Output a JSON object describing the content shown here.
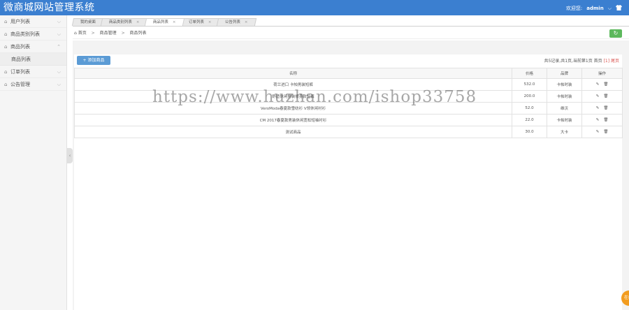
{
  "header": {
    "title": "微商城网站管理系统",
    "welcome": "欢迎您:",
    "username": "admin",
    "dropdown_glyph": "⌵",
    "shirt_icon": "shirt-icon"
  },
  "sidebar": {
    "items": [
      {
        "label": "用户列表",
        "chevron": "⌵"
      },
      {
        "label": "商品类别列表",
        "chevron": "⌵"
      },
      {
        "label": "商品列表",
        "chevron": "⌃"
      },
      {
        "label": "订单列表",
        "chevron": "⌵"
      },
      {
        "label": "公告管理",
        "chevron": "⌵"
      }
    ],
    "subitem": "商品列表",
    "collapse_glyph": "‹"
  },
  "tabs": [
    {
      "label": "我的桌面",
      "close": ""
    },
    {
      "label": "商品类别列表",
      "close": "×"
    },
    {
      "label": "商品列表",
      "close": "×"
    },
    {
      "label": "订单列表",
      "close": "×"
    },
    {
      "label": "公告列表",
      "close": "×"
    }
  ],
  "breadcrumb": {
    "home": "首页",
    "level1": "商品管理",
    "level2": "商品列表",
    "sep": ">",
    "home_glyph": "⌂",
    "refresh_glyph": "↻"
  },
  "toolbar": {
    "add_label": "+ 添加商品",
    "pager_prefix": "共5记录,共1页,当前第1页 首页 ",
    "pager_current": "[1]",
    "pager_last": " 尾页"
  },
  "table": {
    "headers": [
      "名称",
      "价格",
      "品牌",
      "操作"
    ],
    "rows": [
      {
        "name": "荷兰进口 卡帕男装短裤",
        "price": "532.0",
        "brand": "卡帕时装"
      },
      {
        "name": "舒适休闲男装修身款短裤",
        "price": "200.0",
        "brand": "卡帕时装"
      },
      {
        "name": "VeroModa春夏款雪纺衫 V领休闲衬衫",
        "price": "52.0",
        "brand": "维沃"
      },
      {
        "name": "CM 2017春夏款男装休闲宽松短袖衬衫",
        "price": "22.0",
        "brand": "卡帕时装"
      },
      {
        "name": "测试商品",
        "price": "30.0",
        "brand": "大卡"
      }
    ],
    "edit_glyph": "✎",
    "delete_glyph": "🗑"
  },
  "watermark": "https://www.huzhan.com/ishop33758",
  "badge": "在线"
}
